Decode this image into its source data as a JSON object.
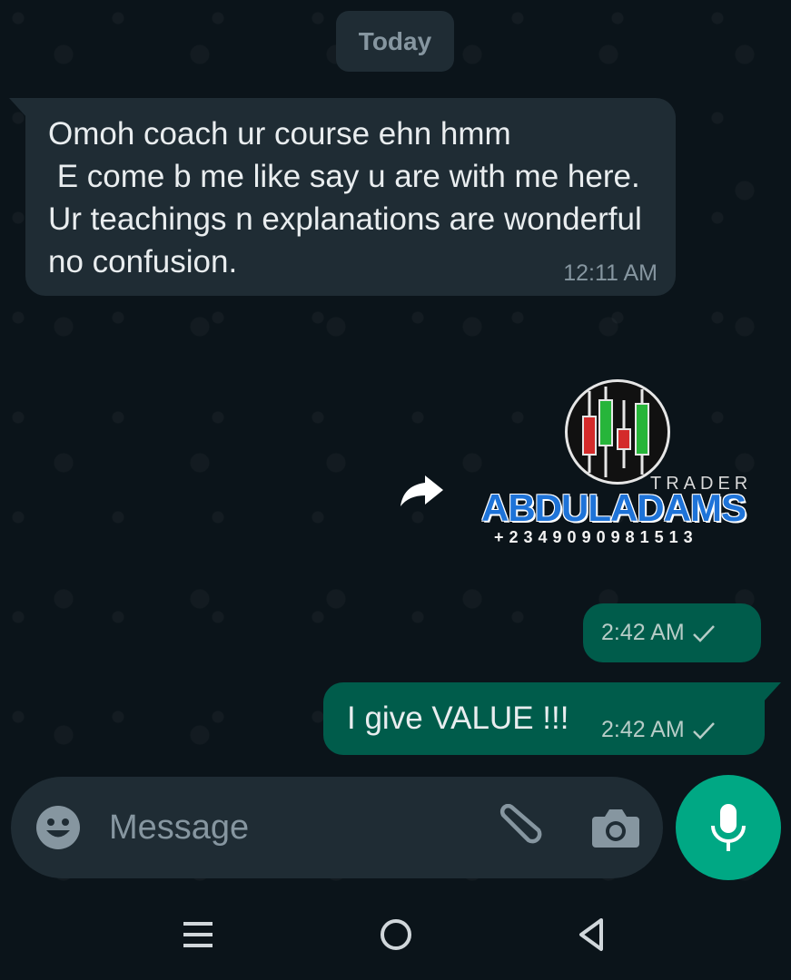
{
  "chat": {
    "date_label": "Today",
    "messages": [
      {
        "direction": "incoming",
        "text": "Omoh coach ur course ehn hmm\n E come b me like say u are with me here.  Ur teachings n explanations are wonderful no confusion.",
        "time": "12:11 AM"
      },
      {
        "direction": "outgoing",
        "type": "image",
        "image": {
          "trader_word": "TRADER",
          "brand_name": "ABDULADAMS",
          "phone": "+2349090981513"
        },
        "time": "2:42 AM",
        "status_icon": "single-check-icon"
      },
      {
        "direction": "outgoing",
        "text": "I give VALUE !!!",
        "time": "2:42 AM",
        "status_icon": "single-check-icon"
      }
    ]
  },
  "composer": {
    "placeholder": "Message",
    "icons": {
      "emoji": "emoji-icon",
      "attach": "paperclip-icon",
      "camera": "camera-icon",
      "mic": "microphone-icon"
    }
  },
  "navbar": {
    "icons": [
      "recents-icon",
      "home-icon",
      "back-icon"
    ]
  },
  "colors": {
    "background": "#0b141a",
    "incoming_bubble": "#1f2c34",
    "outgoing_bubble": "#005c4b",
    "accent": "#00a884",
    "brand_blue": "#1e73d8"
  }
}
